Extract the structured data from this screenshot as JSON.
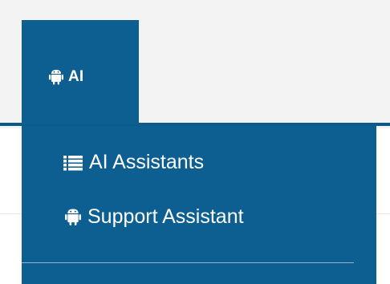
{
  "nav": {
    "tab_label": "AI",
    "tab_icon": "android-icon"
  },
  "dropdown": {
    "items": [
      {
        "label": "AI Assistants",
        "icon": "list-icon"
      },
      {
        "label": "Support Assistant",
        "icon": "android-icon"
      }
    ]
  },
  "colors": {
    "accent": "#0d5f92",
    "page_background": "#f3f3f3",
    "text_on_accent": "#ffffff"
  }
}
